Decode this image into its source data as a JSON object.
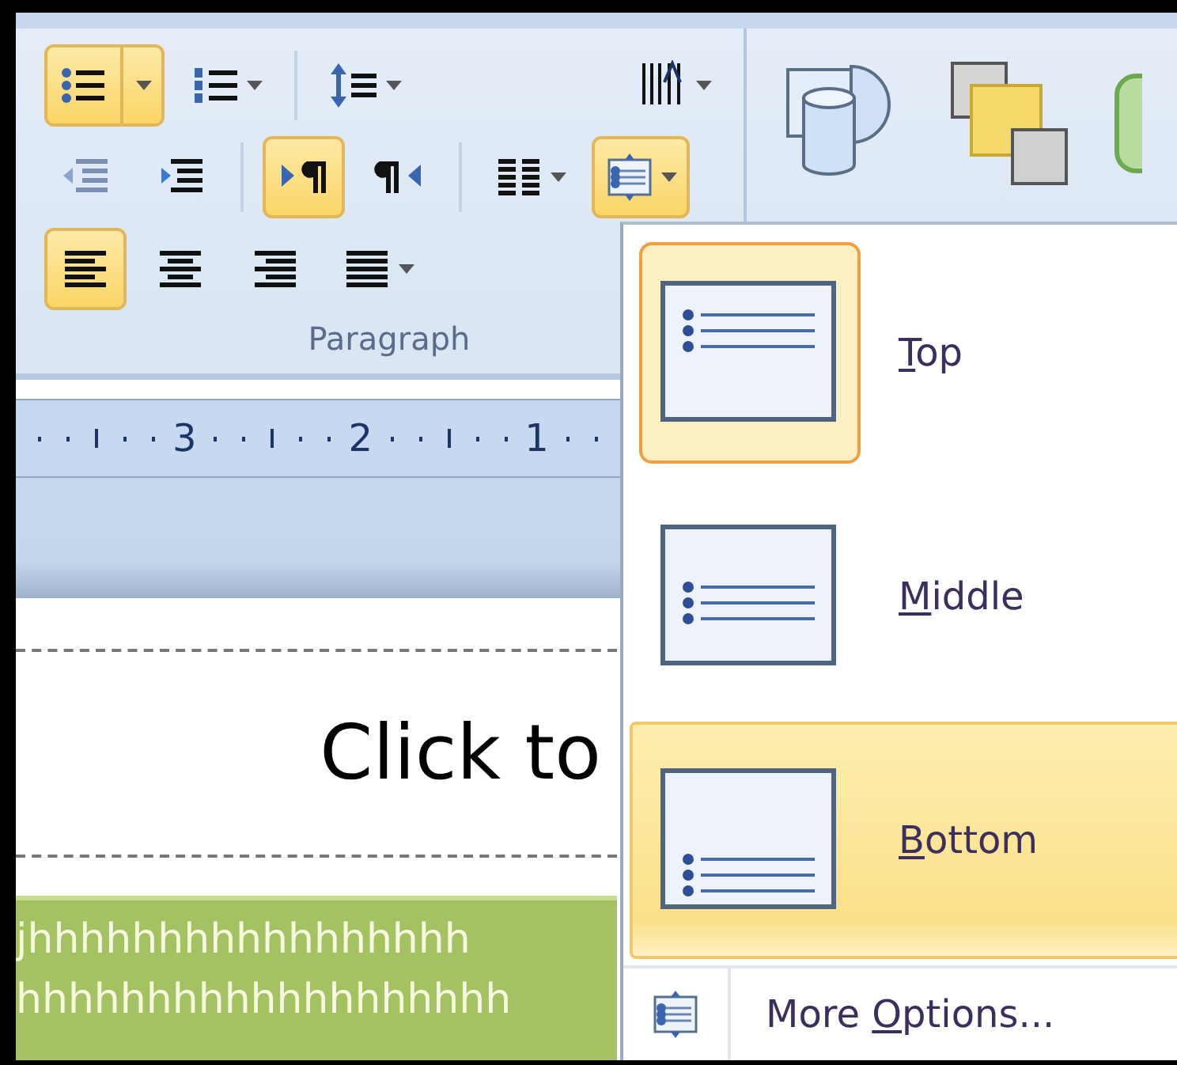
{
  "ribbon": {
    "paragraph_group": {
      "label": "Paragraph",
      "rows": [
        [
          [
            {
              "kind": "bullets",
              "active": true,
              "dropdown": true,
              "split": true
            },
            {
              "kind": "numbering",
              "active": false,
              "dropdown": true,
              "split": false
            }
          ],
          [
            {
              "kind": "line_spacing",
              "active": false,
              "dropdown": true,
              "split": false
            },
            {
              "kind": "text_direction",
              "active": false,
              "dropdown": true,
              "split": false
            }
          ]
        ],
        [
          [
            {
              "kind": "decrease_indent",
              "active": false,
              "dropdown": false,
              "split": false
            },
            {
              "kind": "increase_indent",
              "active": false,
              "dropdown": false,
              "split": false
            }
          ],
          [
            {
              "kind": "ltr",
              "active": true,
              "dropdown": false,
              "split": false
            },
            {
              "kind": "rtl",
              "active": false,
              "dropdown": false,
              "split": false
            }
          ],
          [
            {
              "kind": "columns",
              "active": false,
              "dropdown": true,
              "split": false
            },
            {
              "kind": "align_text",
              "active": true,
              "dropdown": true,
              "split": false
            }
          ]
        ],
        [
          [
            {
              "kind": "align_left",
              "active": true,
              "dropdown": false,
              "split": false
            },
            {
              "kind": "center",
              "active": false,
              "dropdown": false,
              "split": false
            },
            {
              "kind": "align_right",
              "active": false,
              "dropdown": false,
              "split": false
            },
            {
              "kind": "justify",
              "active": false,
              "dropdown": true,
              "split": false
            }
          ]
        ]
      ]
    },
    "drawing_group": {
      "tools": [
        {
          "kind": "shapes"
        },
        {
          "kind": "arrange"
        },
        {
          "kind": "quick_styles"
        }
      ]
    }
  },
  "ruler": {
    "numbers": [
      "3",
      "2",
      "1"
    ]
  },
  "slide": {
    "title_placeholder": "Click to",
    "text_box_lines": [
      "jhhhhhhhhhhhhhhhhh",
      "hhhhhhhhhhhhhhhhhhh"
    ]
  },
  "dropdown": {
    "items": [
      {
        "key": "T",
        "post": "op",
        "kind": "top",
        "checked": true,
        "highlighted": false
      },
      {
        "key": "M",
        "post": "iddle",
        "kind": "middle",
        "checked": false,
        "highlighted": false
      },
      {
        "key": "B",
        "post": "ottom",
        "kind": "bottom",
        "checked": false,
        "highlighted": true
      }
    ],
    "more": {
      "pre": "More ",
      "key": "O",
      "post": "ptions..."
    }
  }
}
